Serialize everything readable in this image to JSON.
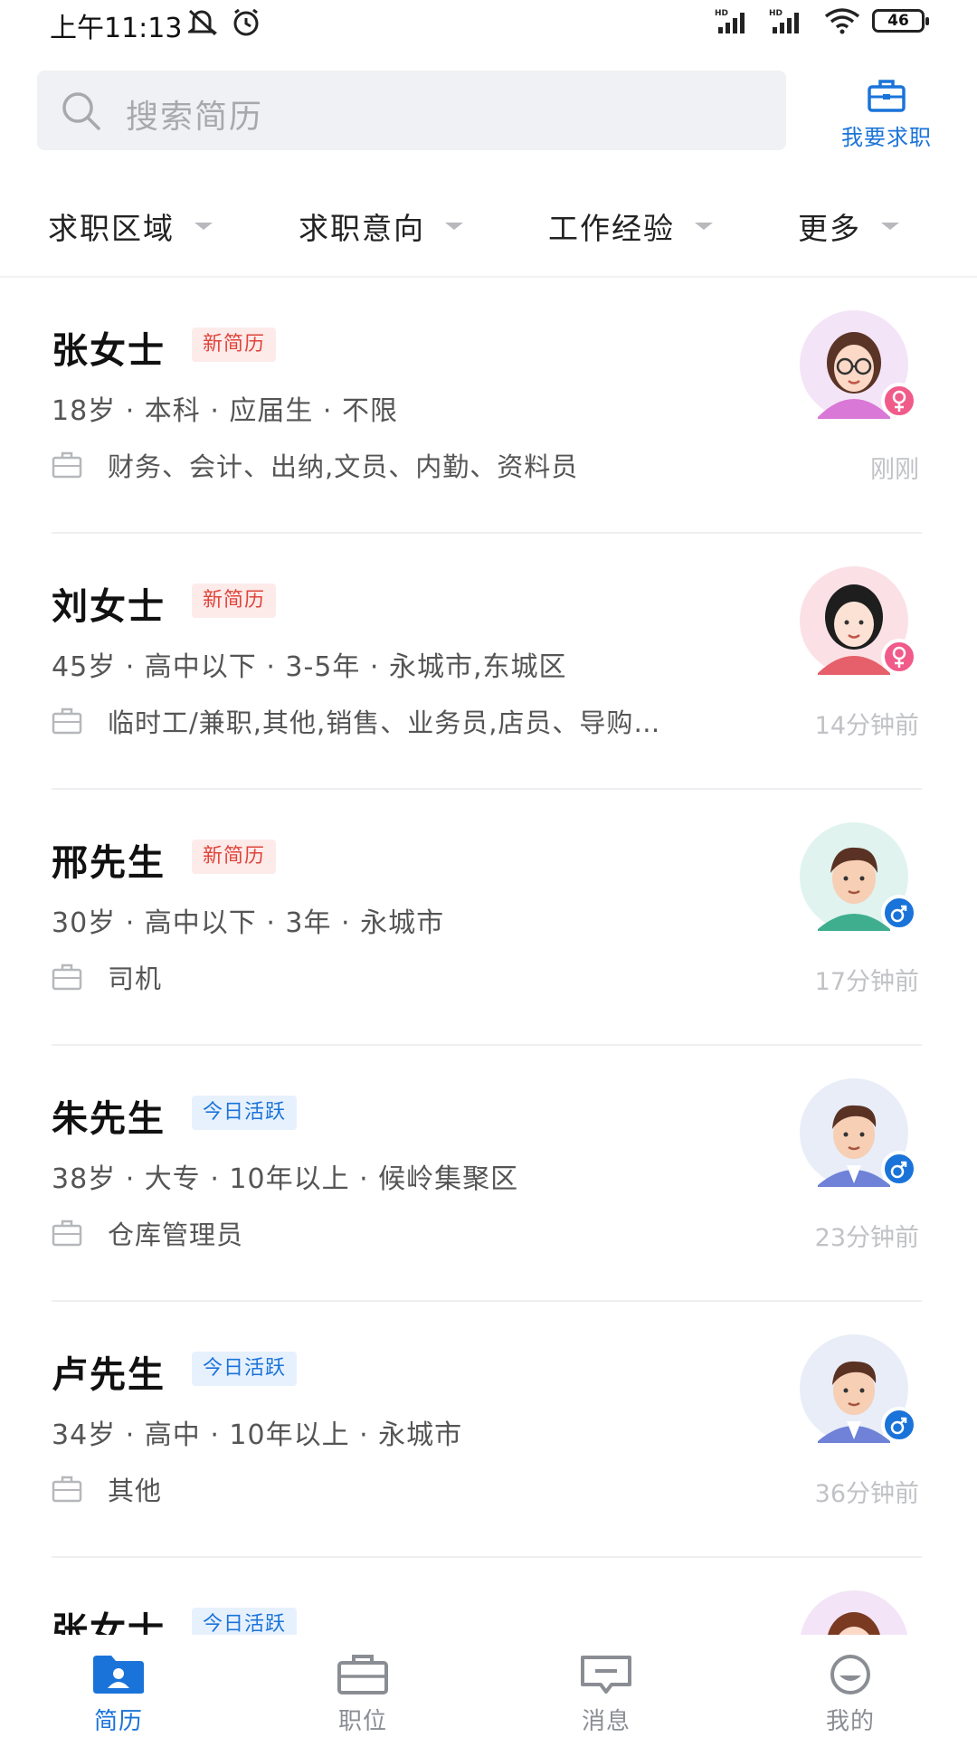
{
  "status_bar": {
    "time": "上午11:13",
    "battery": "46",
    "icons": [
      "mute-icon",
      "alarm-icon",
      "signal-hd-icon",
      "signal-hd-icon",
      "wifi-icon",
      "battery-icon"
    ]
  },
  "search": {
    "placeholder": "搜索简历"
  },
  "header": {
    "jobseek_label": "我要求职"
  },
  "filters": [
    {
      "label": "求职区域"
    },
    {
      "label": "求职意向"
    },
    {
      "label": "工作经验"
    },
    {
      "label": "更多"
    }
  ],
  "resumes": [
    {
      "name": "张女士",
      "badge": "新简历",
      "badge_type": "new",
      "meta": "18岁 · 本科 · 应届生 · 不限",
      "intent": "财务、会计、出纳,文员、内勤、资料员",
      "time": "刚刚",
      "gender": "female"
    },
    {
      "name": "刘女士",
      "badge": "新简历",
      "badge_type": "new",
      "meta": "45岁 · 高中以下 · 3-5年 · 永城市,东城区",
      "intent": "临时工/兼职,其他,销售、业务员,店员、导购…",
      "time": "14分钟前",
      "gender": "female"
    },
    {
      "name": "邢先生",
      "badge": "新简历",
      "badge_type": "new",
      "meta": "30岁 · 高中以下 · 3年 · 永城市",
      "intent": "司机",
      "time": "17分钟前",
      "gender": "male"
    },
    {
      "name": "朱先生",
      "badge": "今日活跃",
      "badge_type": "active",
      "meta": "38岁 · 大专 · 10年以上 · 候岭集聚区",
      "intent": "仓库管理员",
      "time": "23分钟前",
      "gender": "male"
    },
    {
      "name": "卢先生",
      "badge": "今日活跃",
      "badge_type": "active",
      "meta": "34岁 · 高中 · 10年以上 · 永城市",
      "intent": "其他",
      "time": "36分钟前",
      "gender": "male"
    },
    {
      "name": "张女士",
      "badge": "今日活跃",
      "badge_type": "active",
      "meta": "",
      "intent": "",
      "time": "",
      "gender": "female"
    }
  ],
  "tabbar": {
    "items": [
      {
        "label": "简历",
        "icon": "resume-icon",
        "active": true
      },
      {
        "label": "职位",
        "icon": "briefcase-icon",
        "active": false
      },
      {
        "label": "消息",
        "icon": "message-icon",
        "active": false
      },
      {
        "label": "我的",
        "icon": "profile-icon",
        "active": false
      }
    ]
  },
  "colors": {
    "accent": "#1a73d9",
    "new_badge_bg": "#fdebea",
    "new_badge_text": "#e0443a",
    "active_badge_bg": "#e7f1fd",
    "female_badge": "#f05b8a",
    "male_badge": "#1a73d9"
  }
}
